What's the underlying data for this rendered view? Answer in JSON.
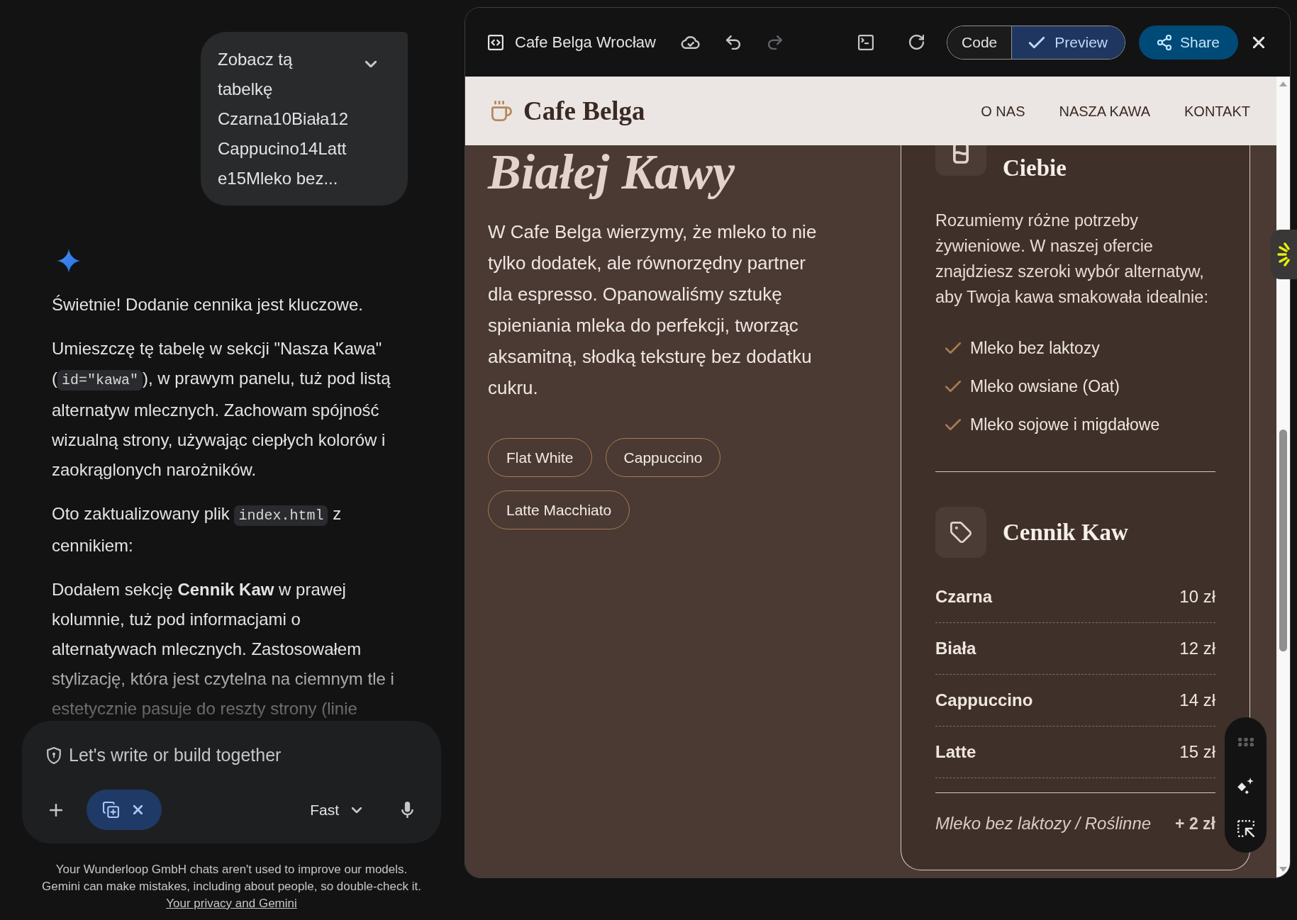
{
  "chat": {
    "user_message": {
      "text": "Zobacz tą tabelkę Czarna10Biała12 Cappucino14Latte15Mleko bez...",
      "expanded": false
    },
    "response": [
      [
        {
          "kind": "text",
          "text": "Świetnie! Dodanie cennika jest kluczowe."
        }
      ],
      [
        {
          "kind": "text",
          "text": "Umieszczę tę tabelę w sekcji \"Nasza Kawa\" ("
        },
        {
          "kind": "code",
          "text": "id=\"kawa\""
        },
        {
          "kind": "text",
          "text": "), w prawym panelu, tuż pod listą alternatyw mlecznych. Zachowam spójność wizualną strony, używając ciepłych kolorów i zaokrąglonych narożników."
        }
      ],
      [
        {
          "kind": "text",
          "text": "Oto zaktualizowany plik "
        },
        {
          "kind": "code",
          "text": "index.html"
        },
        {
          "kind": "text",
          "text": " z cennikiem:"
        }
      ],
      [
        {
          "kind": "text",
          "text": "Dodałem sekcję **Cennik Kaw** w prawej kolumnie, tuż pod informacjami o alternatywach mlecznych. Zastosowałem stylizację, która jest czytelna na ciemnym tle i estetycznie pasuje do reszty strony (linie"
        }
      ]
    ]
  },
  "composer": {
    "placeholder": "Let's write or build together",
    "mode": "Fast"
  },
  "disclaimer": {
    "notice": "Your Wunderloop GmbH chats aren't used to improve our models.",
    "warning": "Gemini can make mistakes, including about people, so double-check it.",
    "link": "Your privacy and Gemini"
  },
  "canvas": {
    "title": "Cafe Belga Wrocław",
    "redo": {
      "disabled": true
    },
    "view_tabs": [
      {
        "label": "Code",
        "selected": false
      },
      {
        "label": "Preview",
        "selected": true
      }
    ],
    "share": "Share"
  },
  "preview": {
    "brand": "Cafe Belga",
    "nav_links": [
      "O NAS",
      "NASZA KAWA",
      "KONTAKT"
    ],
    "hero": {
      "title": "Białej Kawy",
      "text": "W Cafe Belga wierzymy, że mleko to nie tylko dodatek, ale równorzędny partner dla espresso. Opanowaliśmy sztukę spieniania mleka do perfekcji, tworząc aksamitną, słodką teksturę bez dodatku cukru.",
      "tags": [
        "Flat White",
        "Cappuccino",
        "Latte Macchiato"
      ]
    },
    "card": {
      "heading": "Ciebie",
      "text": "Rozumiemy różne potrzeby żywieniowe. W naszej ofercie znajdziesz szeroki wybór alternatyw, aby Twoja kawa smakowała idealnie:",
      "options": [
        "Mleko bez laktozy",
        "Mleko owsiane (Oat)",
        "Mleko sojowe i migdałowe"
      ],
      "price_heading": "Cennik Kaw",
      "prices": [
        {
          "name": "Czarna",
          "price": "10 zł"
        },
        {
          "name": "Biała",
          "price": "12 zł"
        },
        {
          "name": "Cappuccino",
          "price": "14 zł"
        },
        {
          "name": "Latte",
          "price": "15 zł"
        }
      ],
      "extra": {
        "name": "Mleko bez laktozy / Roślinne",
        "price": "+ 2 zł"
      }
    }
  }
}
